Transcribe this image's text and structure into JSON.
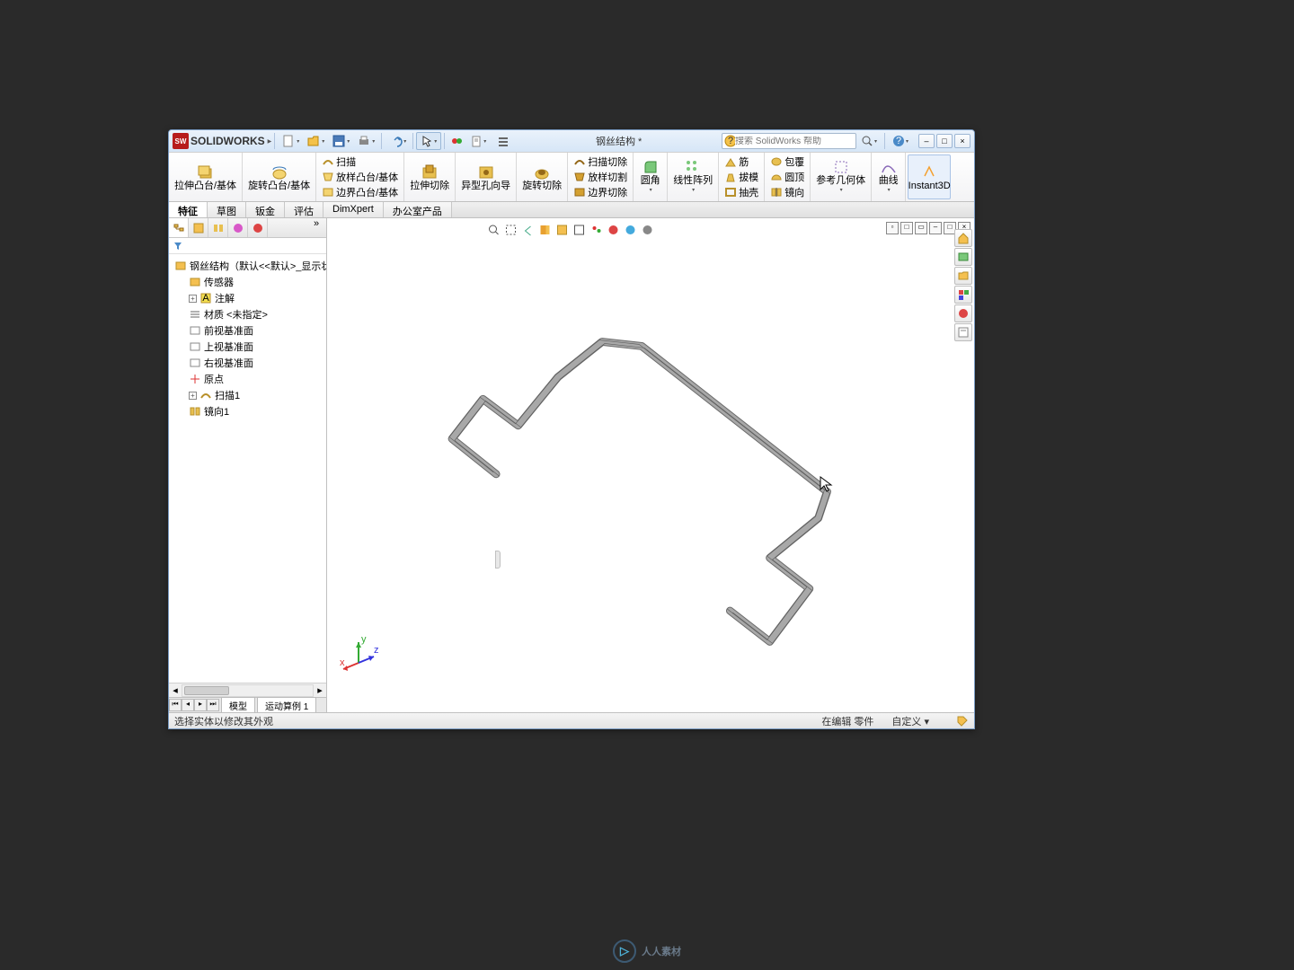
{
  "app": {
    "name": "SOLIDWORKS",
    "logo_letters": "SW"
  },
  "doc_title": "钢丝结构 *",
  "search": {
    "placeholder": "搜索 SolidWorks 帮助"
  },
  "quick_toolbar": {
    "new": "新建",
    "open": "打开",
    "save": "保存",
    "print": "打印",
    "undo": "撤销",
    "select": "选择",
    "rebuild": "重建",
    "options": "选项"
  },
  "win_controls": {
    "min": "–",
    "max": "□",
    "close": "×",
    "help": "?"
  },
  "ribbon": {
    "extrude": "拉伸凸台/基体",
    "revolve": "旋转凸台/基体",
    "sweep": "扫描",
    "loft": "放样凸台/基体",
    "boundary": "边界凸台/基体",
    "extruded_cut": "拉伸切除",
    "hole_wizard": "异型孔向导",
    "revolved_cut": "旋转切除",
    "swept_cut": "扫描切除",
    "lofted_cut": "放样切割",
    "boundary_cut": "边界切除",
    "fillet": "圆角",
    "linear_pattern": "线性阵列",
    "rib": "筋",
    "draft": "拔模",
    "shell": "抽壳",
    "wrap": "包覆",
    "dome": "圆顶",
    "mirror": "镜向",
    "ref_geom": "参考几何体",
    "curves": "曲线",
    "instant3d": "Instant3D"
  },
  "tabs": {
    "features": "特征",
    "sketch": "草图",
    "sheetmetal": "钣金",
    "evaluate": "评估",
    "dimxpert": "DimXpert",
    "office": "办公室产品"
  },
  "tree": {
    "root": "钢丝结构（默认<<默认>_显示状",
    "sensors": "传感器",
    "annotations": "注解",
    "material": "材质 <未指定>",
    "front": "前视基准面",
    "top": "上视基准面",
    "right": "右视基准面",
    "origin": "原点",
    "sweep1": "扫描1",
    "mirror1": "镜向1"
  },
  "bottom_tabs": {
    "model": "模型",
    "motion": "运动算例 1"
  },
  "status": {
    "left": "选择实体以修改其外观",
    "editing": "在编辑 零件",
    "custom": "自定义 ▾"
  },
  "watermark": "人人素材"
}
